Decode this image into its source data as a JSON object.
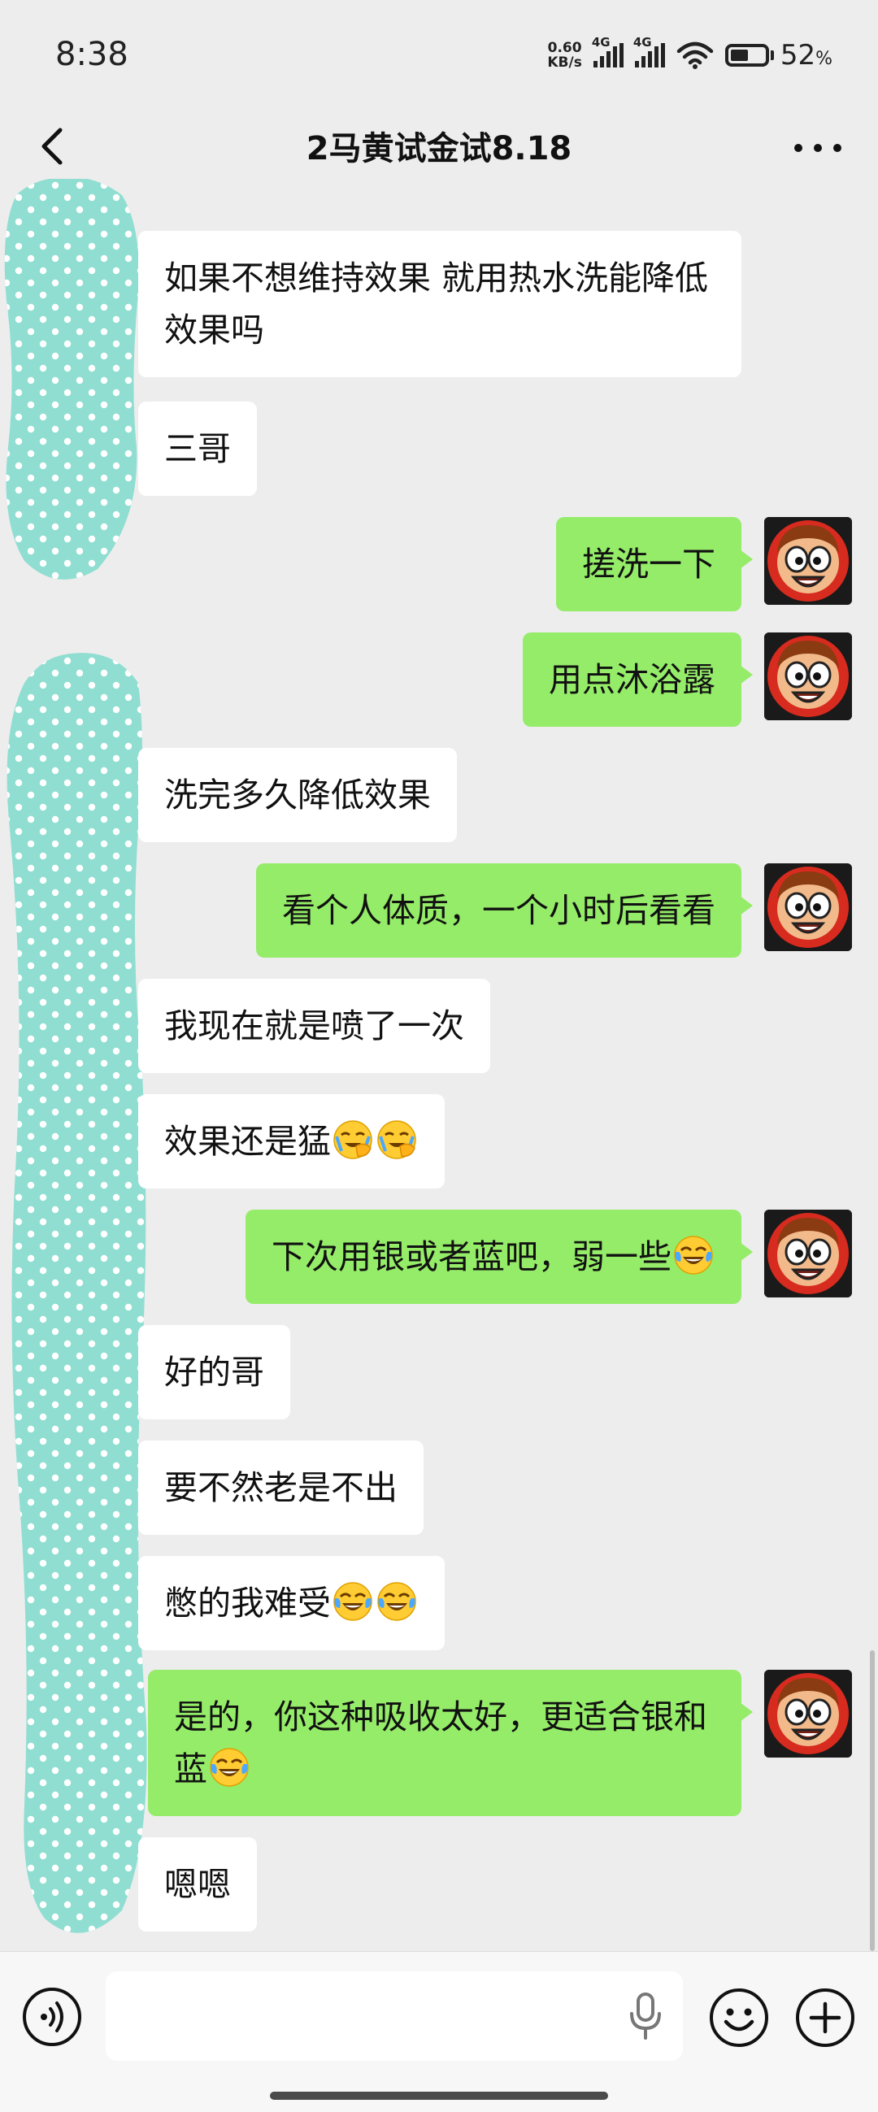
{
  "status_bar": {
    "time": "8:38",
    "net_speed_value": "0.60",
    "net_speed_unit": "KB/s",
    "signal_label_1": "4G",
    "signal_label_2": "4G",
    "battery_percent": "52",
    "battery_unit": "%"
  },
  "header": {
    "title": "2马黄试金试8.18"
  },
  "messages": [
    {
      "side": "in",
      "text": "如果不想维持效果   就用热水洗能降低效果吗"
    },
    {
      "side": "in",
      "text": "三哥"
    },
    {
      "side": "out",
      "text": "搓洗一下"
    },
    {
      "side": "out",
      "text": "用点沐浴露"
    },
    {
      "side": "in",
      "text": "洗完多久降低效果"
    },
    {
      "side": "out",
      "text": "看个人体质，一个小时后看看"
    },
    {
      "side": "in",
      "text": "我现在就是喷了一次"
    },
    {
      "side": "in",
      "text": "效果还是猛"
    },
    {
      "side": "out",
      "text": "下次用银或者蓝吧，弱一些"
    },
    {
      "side": "in",
      "text": "好的哥"
    },
    {
      "side": "in",
      "text": "要不然老是不出"
    },
    {
      "side": "in",
      "text": "憋的我难受"
    },
    {
      "side": "out",
      "text": "是的，你这种吸收太好，更适合银和蓝"
    },
    {
      "side": "in",
      "text": "嗯嗯"
    }
  ],
  "emoji_names": {
    "facepalm_cry": "face-palm-crying-emoji",
    "tears_of_joy": "tears-of-joy-emoji"
  },
  "colors": {
    "outgoing_bubble": "#95ec69",
    "incoming_bubble": "#ffffff",
    "background": "#ededed",
    "redaction_mask": "#8fded1"
  },
  "input_bar": {
    "placeholder": ""
  }
}
